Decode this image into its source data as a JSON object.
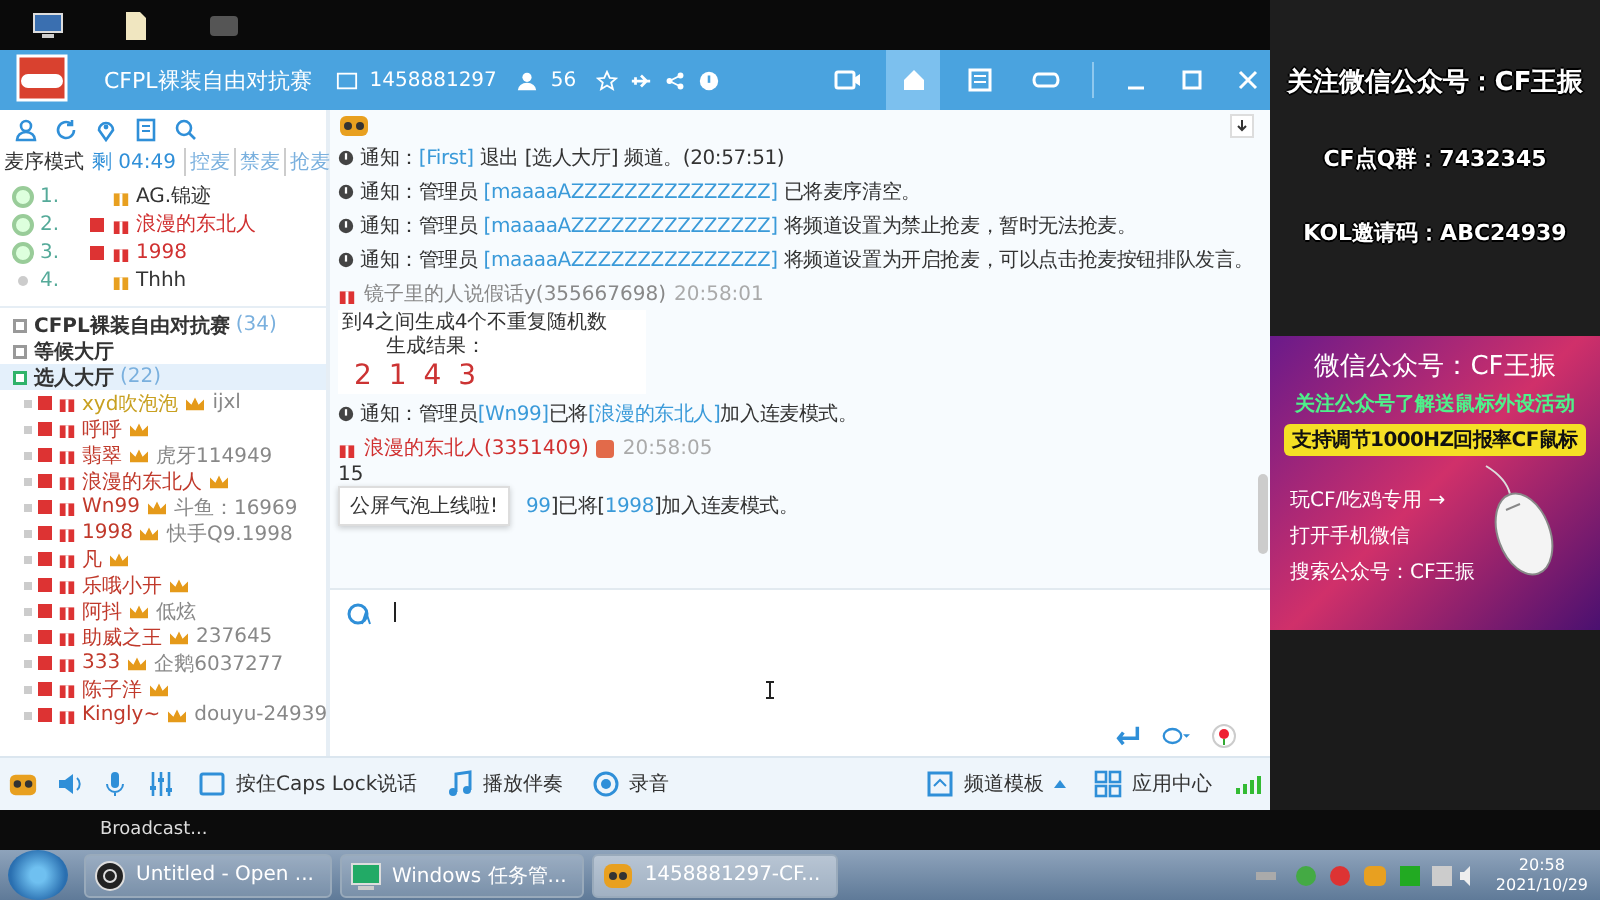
{
  "window": {
    "room_name": "CFPL裸装自由对抗赛",
    "room_id": "1458881297",
    "online_count": "56",
    "tabs": [
      {
        "kind": "video",
        "selected": false
      },
      {
        "kind": "home",
        "selected": true
      },
      {
        "kind": "list",
        "selected": false
      },
      {
        "kind": "game",
        "selected": false
      }
    ]
  },
  "mic_queue": {
    "mode": "麦序模式",
    "timer": "剩 04:49",
    "actions": [
      "控麦",
      "禁麦",
      "抢麦"
    ],
    "items": [
      {
        "index": "1.",
        "name": "AG.锦迹",
        "vip": false,
        "active": true
      },
      {
        "index": "2.",
        "name": "浪漫的东北人",
        "vip": true,
        "active": true
      },
      {
        "index": "3.",
        "name": "1998",
        "vip": true,
        "active": true
      },
      {
        "index": "4.",
        "name": "Thhh",
        "vip": false,
        "active": false
      }
    ]
  },
  "channels": [
    {
      "name": "CFPL裸装自由对抗赛",
      "count": "(34)",
      "selected": false
    },
    {
      "name": "等候大厅",
      "selected": false
    },
    {
      "name": "选人大厅",
      "count": "(22)",
      "selected": true,
      "children": [
        {
          "name": "xyd吹泡泡",
          "note": "ijxl",
          "color": "#c8a020"
        },
        {
          "name": "呼呼",
          "color": "#c0392b"
        },
        {
          "name": "翡翠",
          "note": "虎牙114949",
          "color": "#c0392b"
        },
        {
          "name": "浪漫的东北人",
          "color": "#c0392b"
        },
        {
          "name": "Wn99",
          "note": "斗鱼：16969",
          "color": "#c0392b"
        },
        {
          "name": "1998",
          "note": "快手Q9.1998",
          "color": "#c0392b"
        },
        {
          "name": "凡",
          "color": "#c0392b"
        },
        {
          "name": "乐哦小开",
          "color": "#c0392b"
        },
        {
          "name": "阿抖",
          "note": "低炫",
          "color": "#c0392b"
        },
        {
          "name": "助威之王",
          "note": "237645",
          "color": "#c0392b"
        },
        {
          "name": "333",
          "note": "企鹅6037277",
          "color": "#c0392b"
        },
        {
          "name": "陈子洋",
          "color": "#c0392b"
        },
        {
          "name": "Kingly~",
          "note": "douyu-24939",
          "color": "#c0392b"
        }
      ]
    }
  ],
  "messages": [
    {
      "kind": "notice",
      "label": "通知：",
      "parts": [
        {
          "kind": "link",
          "text": "[First]"
        },
        {
          "kind": "text",
          "text": " 退出 [选人大厅] 频道。(20:57:51)"
        }
      ]
    },
    {
      "kind": "notice",
      "label": "通知：",
      "parts": [
        {
          "kind": "text",
          "text": "管理员 "
        },
        {
          "kind": "link",
          "text": "[maaaaAZZZZZZZZZZZZZZZ]"
        },
        {
          "kind": "text",
          "text": " 已将麦序清空。"
        }
      ]
    },
    {
      "kind": "notice",
      "label": "通知：",
      "parts": [
        {
          "kind": "text",
          "text": "管理员 "
        },
        {
          "kind": "link",
          "text": "[maaaaAZZZZZZZZZZZZZZZ]"
        },
        {
          "kind": "text",
          "text": " 将频道设置为禁止抢麦，暂时无法抢麦。"
        }
      ]
    },
    {
      "kind": "notice",
      "label": "通知：",
      "parts": [
        {
          "kind": "text",
          "text": "管理员 "
        },
        {
          "kind": "link",
          "text": "[maaaaAZZZZZZZZZZZZZZZ]"
        },
        {
          "kind": "text",
          "text": " 将频道设置为开启抢麦，可以点击抢麦按钮排队发言。"
        }
      ]
    },
    {
      "kind": "chat",
      "sender": "镜子里的人说假话y(355667698)",
      "time": "20:58:01",
      "vip": false,
      "card": {
        "lines": [
          "到4之间生成4个不重复随机数",
          "生成结果："
        ],
        "numbers": "2 1 4 3"
      }
    },
    {
      "kind": "notice",
      "label": "通知：",
      "parts": [
        {
          "kind": "text",
          "text": "管理员"
        },
        {
          "kind": "link",
          "text": "[Wn99]"
        },
        {
          "kind": "text",
          "text": "已将"
        },
        {
          "kind": "link",
          "text": "[浪漫的东北人]"
        },
        {
          "kind": "text",
          "text": "加入连麦模式。"
        }
      ]
    },
    {
      "kind": "chat",
      "sender": "浪漫的东北人(3351409)",
      "time": "20:58:05",
      "vip": true,
      "body": "15"
    },
    {
      "kind": "notice",
      "parts": [
        {
          "kind": "link",
          "text": "99"
        },
        {
          "kind": "text",
          "text": "]已将["
        },
        {
          "kind": "link",
          "text": "1998"
        },
        {
          "kind": "text",
          "text": "]加入连麦模式。"
        }
      ]
    }
  ],
  "tooltip": "公屏气泡上线啦!",
  "toolbar": [
    {
      "kind": "caps",
      "label": "按住Caps Lock说话"
    },
    {
      "kind": "music",
      "label": "播放伴奏"
    },
    {
      "kind": "record",
      "label": "录音"
    }
  ],
  "toolbar_right": [
    {
      "kind": "template",
      "label": "频道模板"
    },
    {
      "kind": "apps",
      "label": "应用中心"
    }
  ],
  "status_text": "Broadcast...",
  "promo": {
    "lines": [
      "关注微信公众号：CF王振",
      "CF点Q群：7432345",
      "KOL邀请码：ABC24939"
    ],
    "ad_title": "微信公众号：CF王振",
    "ad_subtitle": "关注公众号了解送鼠标外设活动",
    "ad_banner": "支持调节1000HZ回报率CF鼠标",
    "ad_steps": [
      "玩CF/吃鸡专用 →",
      "打开手机微信",
      "搜索公众号：CF王振"
    ]
  },
  "taskbar": {
    "tasks": [
      {
        "kind": "obs",
        "label": "Untitled - Open ...",
        "selected": false
      },
      {
        "kind": "taskmgr",
        "label": "Windows 任务管...",
        "selected": false
      },
      {
        "kind": "yy",
        "label": "1458881297-CF...",
        "selected": true
      }
    ],
    "time": "20:58",
    "date": "2021/10/29"
  }
}
